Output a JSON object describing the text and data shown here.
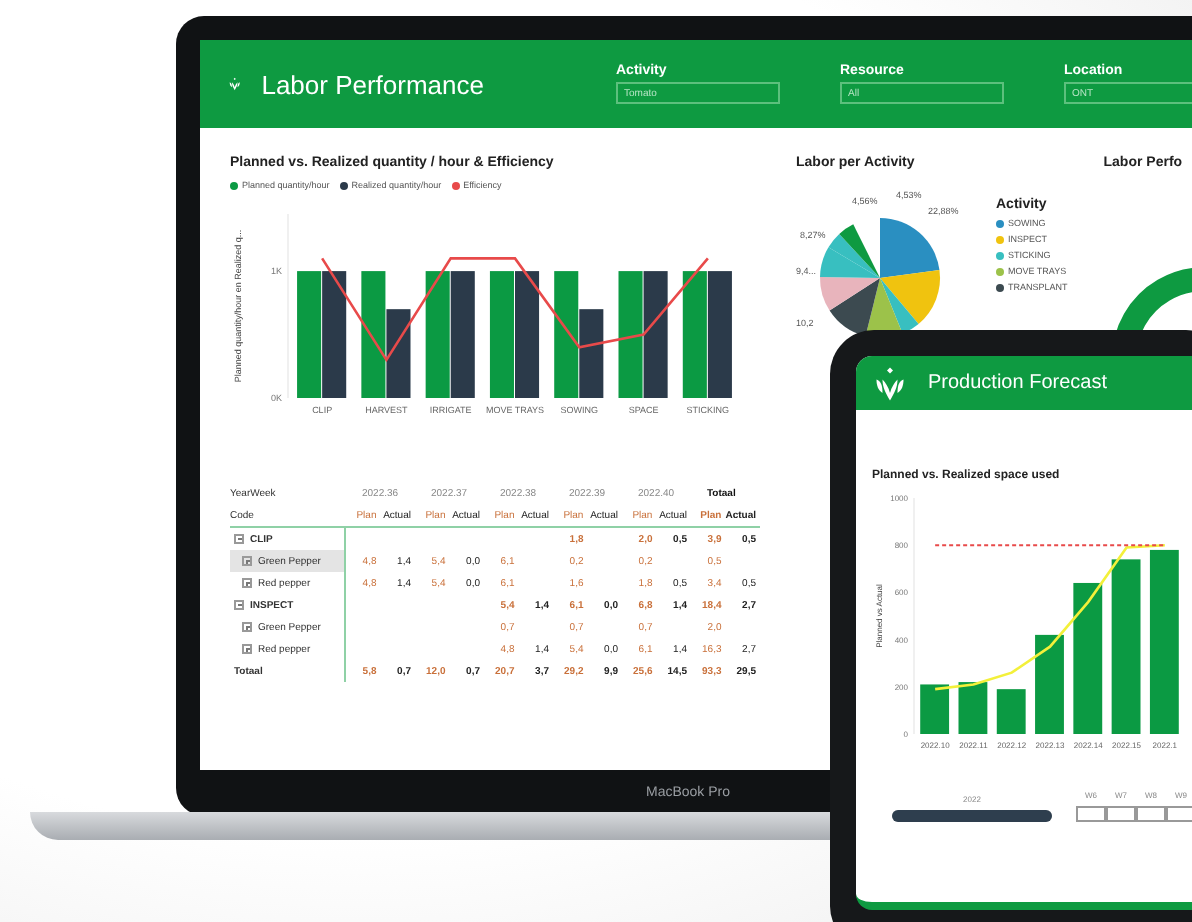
{
  "laptop": {
    "device_label": "MacBook Pro",
    "header": {
      "title": "Labor Performance",
      "filters": [
        {
          "label": "Activity",
          "value": "Tomato"
        },
        {
          "label": "Resource",
          "value": "All"
        },
        {
          "label": "Location",
          "value": "ONT"
        }
      ]
    },
    "efficiency_chart": {
      "title": "Planned vs. Realized quantity / hour & Efficiency",
      "chart_data": {
        "type": "bar",
        "ylabel": "Planned quantity/hour en Realized q...",
        "categories": [
          "CLIP",
          "HARVEST",
          "IRRIGATE",
          "MOVE TRAYS",
          "SOWING",
          "SPACE",
          "STICKING"
        ],
        "ylim": [
          0,
          1.45
        ],
        "yticks": [
          {
            "value": 0,
            "label": "0K"
          },
          {
            "value": 1,
            "label": "1K"
          }
        ],
        "series": [
          {
            "name": "Planned quantity/hour",
            "color": "#0b9a43",
            "values": [
              1,
              1,
              1,
              1,
              1,
              1,
              1
            ]
          },
          {
            "name": "Realized quantity/hour",
            "color": "#2b3a4a",
            "values": [
              1,
              0.7,
              1,
              1,
              0.7,
              1,
              1
            ]
          },
          {
            "name": "Efficiency",
            "color": "#e84a4a",
            "type": "line",
            "values": [
              1.1,
              0.3,
              1.1,
              1.1,
              0.4,
              0.5,
              1.1
            ]
          }
        ]
      }
    },
    "activity_chart": {
      "title": "Labor per Activity",
      "slice_labels": [
        "22,88%",
        "4,53%",
        "4,56%",
        "8,27%",
        "9,4...",
        "10,2"
      ],
      "legend_title": "Activity",
      "legend": [
        {
          "label": "SOWING",
          "color": "#2a8fc1"
        },
        {
          "label": "INSPECT",
          "color": "#f0c30f"
        },
        {
          "label": "STICKING",
          "color": "#38bfc0"
        },
        {
          "label": "MOVE TRAYS",
          "color": "#9cc24a"
        },
        {
          "label": "TRANSPLANT",
          "color": "#3c4a50"
        }
      ]
    },
    "performance_chart": {
      "title": "Labor Perfo"
    },
    "table": {
      "header_label": "YearWeek",
      "weeks": [
        "2022.36",
        "2022.37",
        "2022.38",
        "2022.39",
        "2022.40",
        "Totaal"
      ],
      "code_label": "Code",
      "sub_columns": [
        "Plan",
        "Actual",
        "Plan",
        "Actual",
        "Plan",
        "Actual",
        "Plan",
        "Actual",
        "Plan",
        "Actual",
        "Plan",
        "Actual"
      ],
      "rows": [
        {
          "code": "CLIP",
          "expanded": true,
          "cells": {
            "column_7": "1,8",
            "column_9": "2,0",
            "column_10": "0,5",
            "column_11": "3,9",
            "column_12": "0,5"
          },
          "children": [
            {
              "code": "Green Pepper",
              "expanded": false,
              "selected": true,
              "cells": {
                "column_1": "4,8",
                "column_2": "1,4",
                "column_3": "5,4",
                "column_4": "0,0",
                "column_5": "6,1",
                "column_7": "0,2",
                "column_9": "0,2",
                "column_11": "0,5"
              }
            },
            {
              "code": "Red pepper",
              "expanded": false,
              "selected": false,
              "cells": {
                "column_1": "4,8",
                "column_2": "1,4",
                "column_3": "5,4",
                "column_4": "0,0",
                "column_5": "6,1",
                "column_7": "1,6",
                "column_9": "1,8",
                "column_10": "0,5",
                "column_11": "3,4",
                "column_12": "0,5"
              }
            }
          ]
        },
        {
          "code": "INSPECT",
          "expanded": true,
          "cells": {
            "column_5": "5,4",
            "column_6": "1,4",
            "column_7": "6,1",
            "column_8": "0,0",
            "column_9": "6,8",
            "column_10": "1,4",
            "column_11": "18,4",
            "column_12": "2,7"
          },
          "children": [
            {
              "code": "Green Pepper",
              "expanded": false,
              "selected": false,
              "cells": {
                "column_5": "0,7",
                "column_7": "0,7",
                "column_9": "0,7",
                "column_11": "2,0"
              }
            },
            {
              "code": "Red pepper",
              "expanded": false,
              "selected": false,
              "cells": {
                "column_5": "4,8",
                "column_6": "1,4",
                "column_7": "5,4",
                "column_8": "0,0",
                "column_9": "6,1",
                "column_10": "1,4",
                "column_11": "16,3",
                "column_12": "2,7"
              }
            }
          ]
        }
      ],
      "total": {
        "code": "Totaal",
        "cells": {
          "column_1": "5,8",
          "column_2": "0,7",
          "column_3": "12,0",
          "column_4": "0,7",
          "column_5": "20,7",
          "column_6": "3,7",
          "column_7": "29,2",
          "column_8": "9,9",
          "column_9": "25,6",
          "column_10": "14,5",
          "column_11": "93,3",
          "column_12": "29,5"
        }
      }
    }
  },
  "tablet": {
    "header": {
      "title": "Production Forecast"
    },
    "space_chart": {
      "title": "Planned vs. Realized space used",
      "chart_data": {
        "type": "bar",
        "ylabel": "Planned vs Actual",
        "categories": [
          "2022.10",
          "2022.11",
          "2022.12",
          "2022.13",
          "2022.14",
          "2022.15",
          "2022.1"
        ],
        "ylim": [
          0,
          1000
        ],
        "yticks": [
          0,
          200,
          400,
          600,
          800,
          1000
        ],
        "series": [
          {
            "color": "#0b9a43",
            "values": [
              210,
              220,
              190,
              420,
              640,
              740,
              780
            ]
          },
          {
            "color": "#f3f03a",
            "type": "line",
            "values": [
              190,
              210,
              260,
              370,
              560,
              790,
              800
            ]
          },
          {
            "color": "#e84a4a",
            "type": "line",
            "line_style": "dashed",
            "values": [
              800,
              800,
              800,
              800,
              800,
              800,
              800
            ]
          }
        ]
      }
    },
    "year_slider": {
      "label": "2022",
      "level": 1
    },
    "weeks": [
      {
        "label": "W6",
        "selected": false
      },
      {
        "label": "W7",
        "selected": false
      },
      {
        "label": "W8",
        "selected": false
      },
      {
        "label": "W9",
        "selected": false
      }
    ]
  }
}
